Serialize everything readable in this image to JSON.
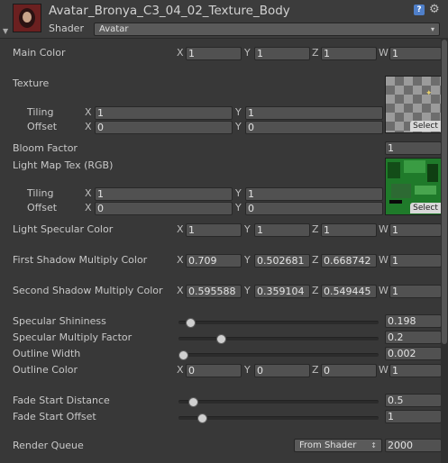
{
  "header": {
    "title": "Avatar_Bronya_C3_04_02_Texture_Body",
    "shader_label": "Shader",
    "shader_value": "Avatar",
    "help_glyph": "?",
    "gear_glyph": "⚙",
    "fold_glyph": "▼",
    "dropdown_glyph": "▾"
  },
  "properties": {
    "main_color": {
      "label": "Main Color",
      "x": "1",
      "y": "1",
      "z": "1",
      "w": "1"
    },
    "texture": {
      "label": "Texture",
      "tiling_label": "Tiling",
      "offset_label": "Offset",
      "tiling_x": "1",
      "tiling_y": "1",
      "offset_x": "0",
      "offset_y": "0",
      "select_label": "Select"
    },
    "bloom_factor": {
      "label": "Bloom Factor",
      "value": "1"
    },
    "light_map_tex": {
      "label": "Light Map Tex (RGB)",
      "tiling_label": "Tiling",
      "offset_label": "Offset",
      "tiling_x": "1",
      "tiling_y": "1",
      "offset_x": "0",
      "offset_y": "0",
      "select_label": "Select"
    },
    "light_specular_color": {
      "label": "Light Specular Color",
      "x": "1",
      "y": "1",
      "z": "1",
      "w": "1"
    },
    "first_shadow_multiply_color": {
      "label": "First Shadow Multiply Color",
      "x": "0.709",
      "y": "0.502681",
      "z": "0.668742",
      "w": "1"
    },
    "second_shadow_multiply_color": {
      "label": "Second Shadow Multiply Color",
      "x": "0.595588",
      "y": "0.359104",
      "z": "0.549445",
      "w": "1"
    },
    "specular_shininess": {
      "label": "Specular Shininess",
      "value": "0.198",
      "slider_fraction": 0.04
    },
    "specular_multiply_factor": {
      "label": "Specular Multiply Factor",
      "value": "0.2",
      "slider_fraction": 0.2
    },
    "outline_width": {
      "label": "Outline Width",
      "value": "0.002",
      "slider_fraction": 0.0
    },
    "outline_color": {
      "label": "Outline Color",
      "x": "0",
      "y": "0",
      "z": "0",
      "w": "1"
    },
    "fade_start_distance": {
      "label": "Fade Start Distance",
      "value": "0.5",
      "slider_fraction": 0.05
    },
    "fade_start_offset": {
      "label": "Fade Start Offset",
      "value": "1",
      "slider_fraction": 0.1
    },
    "render_queue": {
      "label": "Render Queue",
      "mode": "From Shader",
      "mode_glyph": "↕",
      "value": "2000"
    }
  },
  "component_labels": {
    "x": "X",
    "y": "Y",
    "z": "Z",
    "w": "W"
  },
  "colors": {
    "background": "#383838",
    "field": "#515151",
    "text": "#c8c8c8"
  }
}
